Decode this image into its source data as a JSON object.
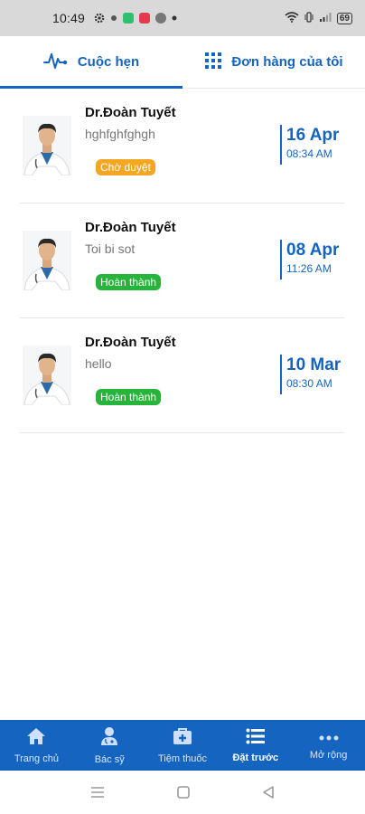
{
  "status_bar": {
    "time": "10:49",
    "icons": [
      "gear-icon",
      "dot-icon",
      "app-icon-green",
      "app-icon-red",
      "app-icon-grey",
      "dot-icon"
    ],
    "right_icons": [
      "wifi-icon",
      "vibrate-icon",
      "signal-icon",
      "battery-icon"
    ],
    "battery": "69"
  },
  "top_tabs": [
    {
      "label": "Cuộc hẹn",
      "icon": "heartbeat-icon",
      "active": true
    },
    {
      "label": "Đơn hàng của tôi",
      "icon": "grid-icon",
      "active": false
    }
  ],
  "appointments": [
    {
      "doctor": "Dr.Đoàn Tuyết",
      "note": "hghfghfghgh",
      "status": "Chờ duyệt",
      "day": "16 Apr",
      "time": "08:34 AM"
    },
    {
      "doctor": "Dr.Đoàn Tuyết",
      "note": "Toi bi sot",
      "status": "Hoàn thành",
      "day": "08 Apr",
      "time": "11:26 AM"
    },
    {
      "doctor": "Dr.Đoàn Tuyết",
      "note": "hello",
      "status": "Hoàn thành",
      "day": "10 Mar",
      "time": "08:30 AM"
    }
  ],
  "bottom_nav": [
    {
      "label": "Trang chủ",
      "icon": "home-icon",
      "active": false
    },
    {
      "label": "Bác sỹ",
      "icon": "doctor-icon",
      "active": false
    },
    {
      "label": "Tiệm thuốc",
      "icon": "medical-bag-icon",
      "active": false
    },
    {
      "label": "Đặt trước",
      "icon": "list-icon",
      "active": true
    },
    {
      "label": "Mở rộng",
      "icon": "more-icon",
      "active": false
    }
  ],
  "colors": {
    "primary": "#1565c0",
    "pending": "#f5a623",
    "done": "#27b43a"
  }
}
